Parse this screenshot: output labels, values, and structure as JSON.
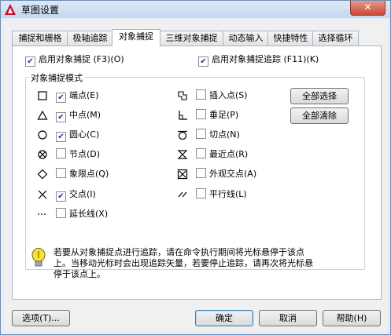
{
  "window": {
    "title": "草图设置",
    "close_glyph": "✕"
  },
  "tabs": [
    {
      "label": "捕捉和栅格"
    },
    {
      "label": "极轴追踪"
    },
    {
      "label": "对象捕捉"
    },
    {
      "label": "三维对象捕捉"
    },
    {
      "label": "动态输入"
    },
    {
      "label": "快捷特性"
    },
    {
      "label": "选择循环"
    }
  ],
  "active_tab": "对象捕捉",
  "snap_on": {
    "label": "启用对象捕捉 (F3)(O)",
    "checked": true
  },
  "track_on": {
    "label": "启用对象捕捉追踪 (F11)(K)",
    "checked": true
  },
  "modes_group": {
    "label": "对象捕捉模式"
  },
  "modes_left": [
    {
      "label": "端点(E)",
      "checked": true,
      "icon": "square-icon"
    },
    {
      "label": "中点(M)",
      "checked": true,
      "icon": "triangle-icon"
    },
    {
      "label": "圆心(C)",
      "checked": true,
      "icon": "circle-icon"
    },
    {
      "label": "节点(D)",
      "checked": false,
      "icon": "node-icon"
    },
    {
      "label": "象限点(Q)",
      "checked": false,
      "icon": "diamond-icon"
    },
    {
      "label": "交点(I)",
      "checked": true,
      "icon": "cross-icon"
    },
    {
      "label": "延长线(X)",
      "checked": false,
      "icon": "extension-icon"
    }
  ],
  "modes_right": [
    {
      "label": "插入点(S)",
      "checked": false,
      "icon": "insert-icon"
    },
    {
      "label": "垂足(P)",
      "checked": false,
      "icon": "perpendicular-icon"
    },
    {
      "label": "切点(N)",
      "checked": false,
      "icon": "tangent-icon"
    },
    {
      "label": "最近点(R)",
      "checked": false,
      "icon": "nearest-icon"
    },
    {
      "label": "外观交点(A)",
      "checked": false,
      "icon": "apparent-intersection-icon"
    },
    {
      "label": "平行线(L)",
      "checked": false,
      "icon": "parallel-icon"
    }
  ],
  "buttons": {
    "select_all": "全部选择",
    "clear_all": "全部清除",
    "options": "选项(T)...",
    "ok": "确定",
    "cancel": "取消",
    "help": "帮助(H)"
  },
  "tip": "若要从对象捕捉点进行追踪，请在命令执行期间将光标悬停于该点上。当移动光标时会出现追踪矢量，若要停止追踪，请再次将光标悬停于该点上。",
  "check_glyph": "✔"
}
